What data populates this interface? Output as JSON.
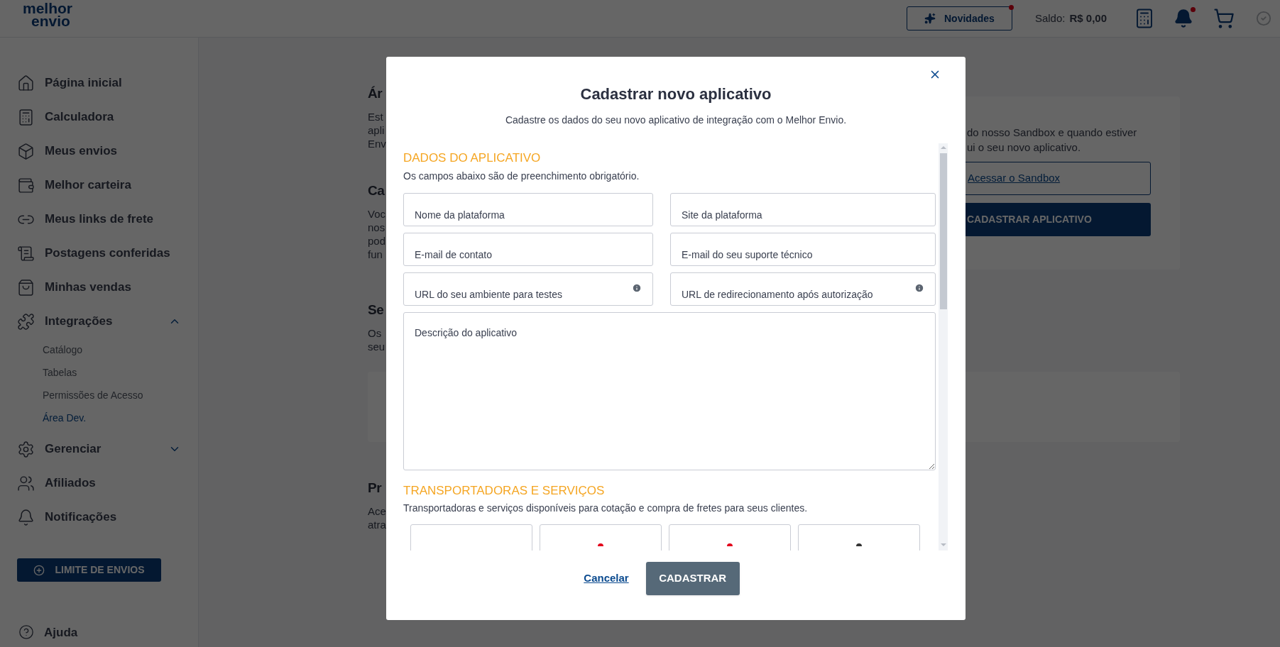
{
  "header": {
    "logo_top": "melhor",
    "logo_bottom": "envio",
    "news_button": {
      "label": "Novidades",
      "badge": true
    },
    "balance_label": "Saldo:",
    "balance_value": "R$ 0,00",
    "bell_badge": true
  },
  "sidebar": {
    "items": [
      {
        "label": "Página inicial"
      },
      {
        "label": "Calculadora"
      },
      {
        "label": "Meus envios"
      },
      {
        "label": "Melhor carteira"
      },
      {
        "label": "Meus links de frete"
      },
      {
        "label": "Postagens conferidas"
      },
      {
        "label": "Minhas vendas"
      },
      {
        "label": "Integrações",
        "expanded": true,
        "children": [
          {
            "label": "Catálogo",
            "selected": false
          },
          {
            "label": "Tabelas",
            "selected": false
          },
          {
            "label": "Permissões de Acesso",
            "selected": false
          },
          {
            "label": "Área Dev.",
            "selected": true
          }
        ]
      },
      {
        "label": "Gerenciar",
        "expanded": false
      },
      {
        "label": "Afiliados"
      },
      {
        "label": "Notificações"
      }
    ],
    "limit_button": "LIMITE DE ENVIOS",
    "help": "Ajuda"
  },
  "background": {
    "sections": [
      {
        "heading": "Ár",
        "lines": [
          "Est",
          "apli",
          "Env"
        ]
      },
      {
        "heading": "Ca",
        "lines": [
          "Voc",
          "nos",
          "pod",
          "fun"
        ]
      },
      {
        "heading": "Se",
        "lines": [
          "Os",
          "seu"
        ],
        "card": true
      },
      {
        "heading": "Pr",
        "lines": [
          "Ace",
          "atra"
        ]
      }
    ],
    "right_card": {
      "lines": [
        "do nosso Sandbox e quando estiver",
        "ui o seu novo aplicativo."
      ],
      "link_button": "Acessar o Sandbox",
      "primary_button": "CADASTRAR APLICATIVO"
    }
  },
  "modal": {
    "title": "Cadastrar novo aplicativo",
    "subtitle": "Cadastre os dados do seu novo aplicativo de integração com o Melhor Envio.",
    "section_1": {
      "heading": "DADOS DO APLICATIVO",
      "note": "Os campos abaixo são de preenchimento obrigatório."
    },
    "fields": [
      {
        "placeholder": "Nome da plataforma",
        "info": false
      },
      {
        "placeholder": "Site da plataforma",
        "info": false
      },
      {
        "placeholder": "E-mail de contato",
        "info": false
      },
      {
        "placeholder": "E-mail do seu suporte técnico",
        "info": false
      },
      {
        "placeholder": "URL do seu ambiente para testes",
        "info": true
      },
      {
        "placeholder": "URL de redirecionamento após autorização",
        "info": true
      }
    ],
    "description": {
      "placeholder": "Descrição do aplicativo"
    },
    "section_2": {
      "heading": "TRANSPORTADORAS E SERVIÇOS",
      "note": "Transportadoras e serviços disponíveis para cotação e compra de fretes para seus clientes."
    },
    "carriers": [
      {
        "kind": "empty"
      },
      {
        "kind": "mark",
        "color": "#e3001b"
      },
      {
        "kind": "mark",
        "color": "#e3001b"
      },
      {
        "kind": "mark",
        "color": "#333333"
      }
    ],
    "cancel": "Cancelar",
    "submit": "CADASTRAR"
  }
}
